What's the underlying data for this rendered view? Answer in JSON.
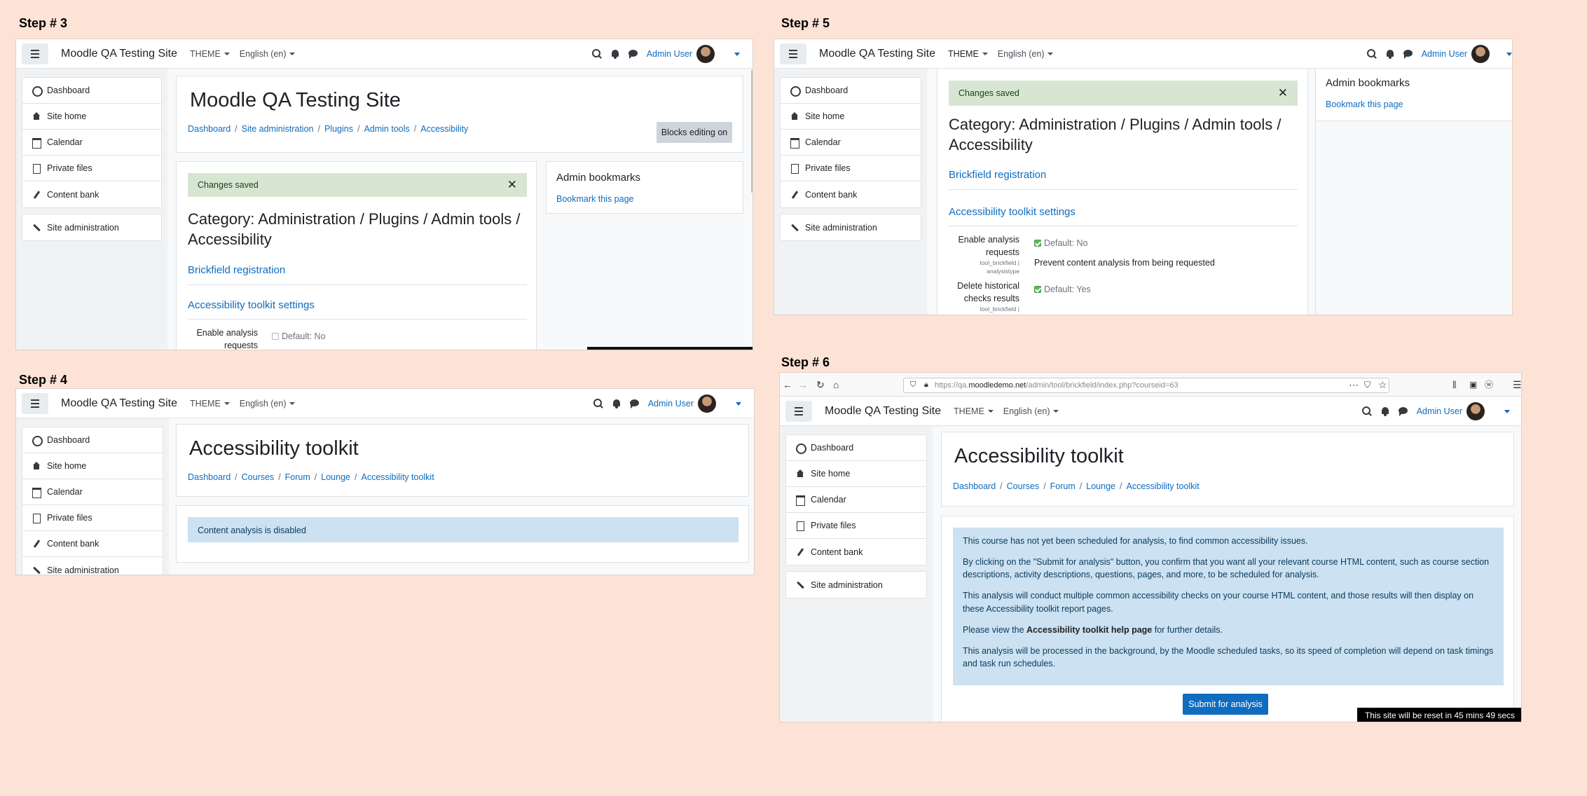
{
  "steps": {
    "s3": "Step # 3",
    "s4": "Step # 4",
    "s5": "Step # 5",
    "s6": "Step # 6"
  },
  "nav": {
    "site_name": "Moodle QA Testing Site",
    "theme": "THEME",
    "language": "English (en)",
    "user": "Admin User"
  },
  "drawer": {
    "items": [
      "Dashboard",
      "Site home",
      "Calendar",
      "Private files",
      "Content bank"
    ],
    "admin": "Site administration"
  },
  "step3": {
    "title": "Moodle QA Testing Site",
    "crumbs": [
      "Dashboard",
      "Site administration",
      "Plugins",
      "Admin tools",
      "Accessibility"
    ],
    "blocks_btn": "Blocks editing on"
  },
  "settings": {
    "changes_saved": "Changes saved",
    "category": "Category: Administration / Plugins / Admin tools / Accessibility",
    "brickfield": "Brickfield registration",
    "toolkit_settings": "Accessibility toolkit settings",
    "enable_label": "Enable analysis requests",
    "enable_sub1": "tool_brickfield |",
    "enable_sub2": "analysistype",
    "default_no": "Default: No",
    "prevent": "Prevent content analysis from being requested",
    "delete_label": "Delete historical checks results",
    "delete_sub": "tool_brickfield |",
    "default_yes": "Default: Yes"
  },
  "bookmarks": {
    "title": "Admin bookmarks",
    "link": "Bookmark this page"
  },
  "toolkit": {
    "title": "Accessibility toolkit",
    "crumbs": [
      "Dashboard",
      "Courses",
      "Forum",
      "Lounge",
      "Accessibility toolkit"
    ],
    "disabled": "Content analysis is disabled",
    "p1": "This course has not yet been scheduled for analysis, to find common accessibility issues.",
    "p2": "By clicking on the \"Submit for analysis\" button, you confirm that you want all your relevant course HTML content, such as course section descriptions, activity descriptions, questions, pages, and more, to be scheduled for analysis.",
    "p3": "This analysis will conduct multiple common accessibility checks on your course HTML content, and those results will then display on these Accessibility toolkit report pages.",
    "p4_pre": "Please view the ",
    "p4_link": "Accessibility toolkit help page",
    "p4_post": " for further details.",
    "p5": "This analysis will be processed in the background, by the Moodle scheduled tasks, so its speed of completion will depend on task timings and task run schedules.",
    "submit": "Submit for analysis",
    "reset": "This site will be reset in 45 mins 49 secs"
  },
  "browser": {
    "url_pre": "https://qa.",
    "url_domain": "moodledemo.net",
    "url_post": "/admin/tool/brickfield/index.php?courseid=63"
  },
  "colors": {
    "background": "#fde3d6",
    "link": "#0f6cbf",
    "success_bg": "#d7e6d2",
    "info_bg": "#cce1f1"
  }
}
